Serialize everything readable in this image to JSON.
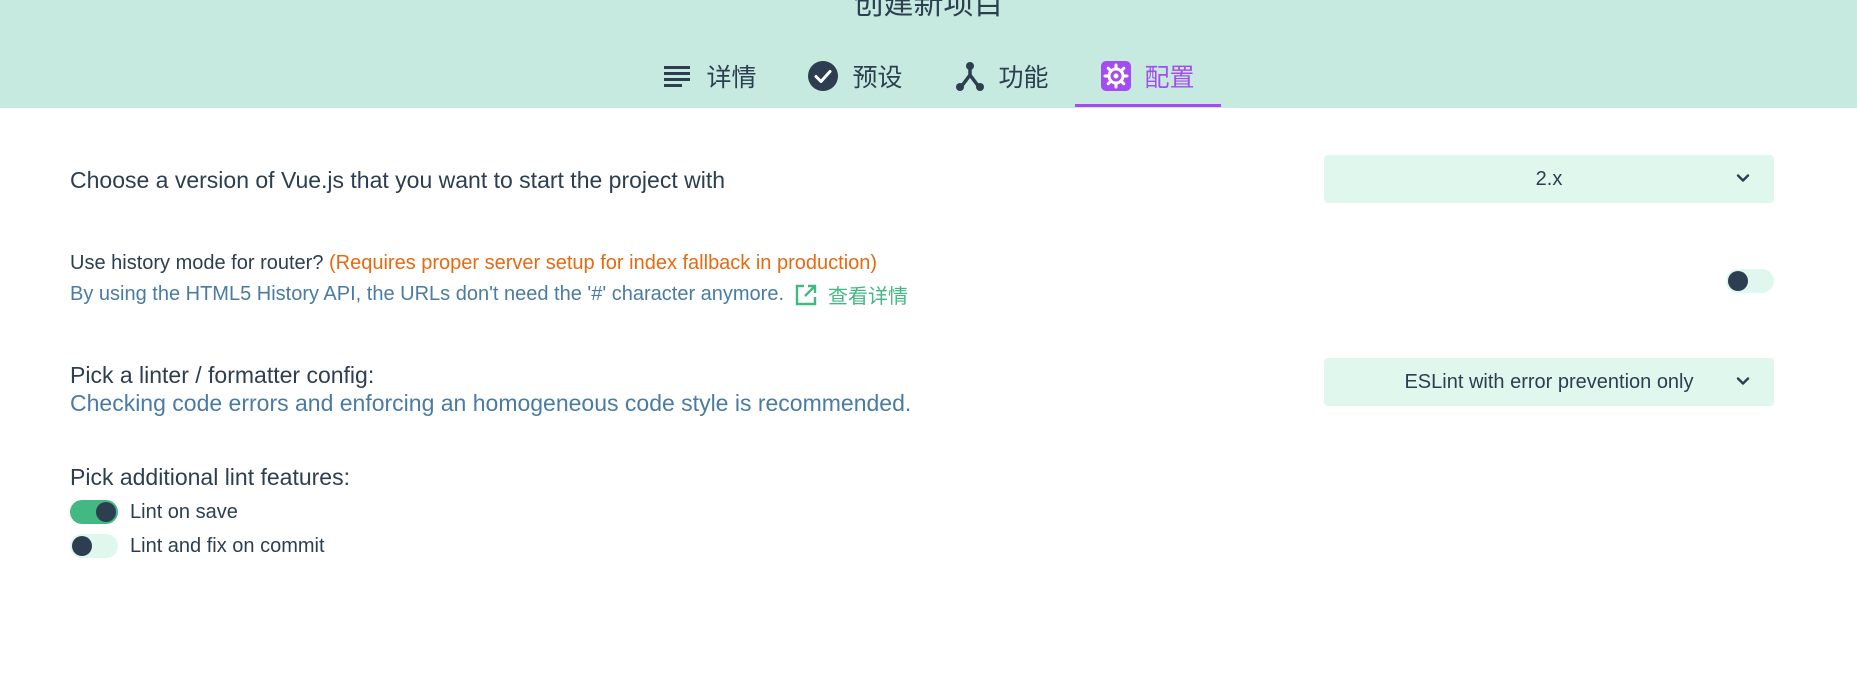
{
  "page": {
    "title": "创建新项目"
  },
  "tabs": [
    {
      "label": "详情",
      "icon": "list-icon",
      "active": false
    },
    {
      "label": "预设",
      "icon": "check-circle-icon",
      "active": false
    },
    {
      "label": "功能",
      "icon": "fork-icon",
      "active": false
    },
    {
      "label": "配置",
      "icon": "gear-icon",
      "active": true
    }
  ],
  "config": {
    "vue_version": {
      "label": "Choose a version of Vue.js that you want to start the project with",
      "value": "2.x"
    },
    "history_mode": {
      "label": "Use history mode for router?",
      "warning": "(Requires proper server setup for index fallback in production)",
      "description": "By using the HTML5 History API, the URLs don't need the '#' character anymore.",
      "link_label": "查看详情",
      "enabled": false
    },
    "linter": {
      "label": "Pick a linter / formatter config:",
      "description": "Checking code errors and enforcing an homogeneous code style is recommended.",
      "value": "ESLint with error prevention only"
    },
    "lint_features": {
      "label": "Pick additional lint features:",
      "options": [
        {
          "label": "Lint on save",
          "enabled": true
        },
        {
          "label": "Lint and fix on commit",
          "enabled": false
        }
      ]
    }
  },
  "colors": {
    "header_bg": "#c6eadf",
    "accent": "#a44cf1",
    "green": "#42b983",
    "warning": "#e8690f",
    "description": "#4a7ba3"
  }
}
